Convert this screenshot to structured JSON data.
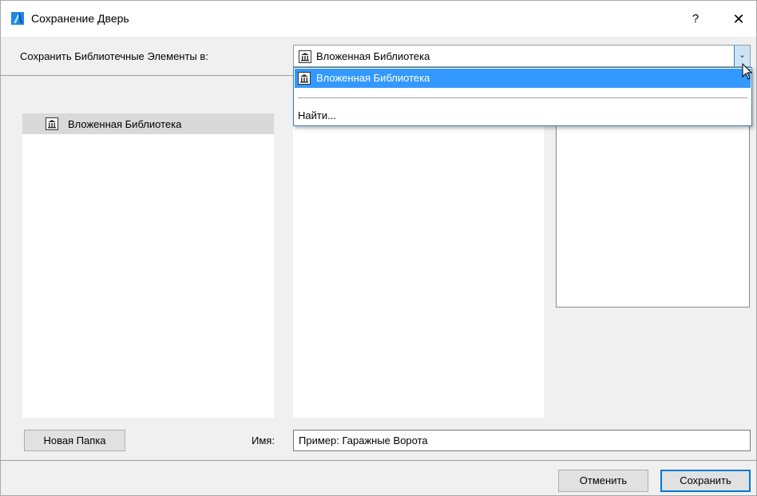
{
  "window": {
    "title": "Сохранение Дверь",
    "help_glyph": "?",
    "close_glyph": "✕"
  },
  "save_to": {
    "label": "Сохранить Библиотечные Элементы в:",
    "selected": "Вложенная Библиотека",
    "arrow_glyph": "⌄",
    "dropdown": {
      "items": [
        {
          "label": "Вложенная Библиотека",
          "icon": "library-icon",
          "selected": true
        }
      ],
      "find_label": "Найти..."
    }
  },
  "tree": {
    "items": [
      {
        "label": "Вложенная Библиотека",
        "icon": "library-icon"
      }
    ]
  },
  "footer": {
    "new_folder_label": "Новая Папка",
    "name_label": "Имя:",
    "name_value": "Пример: Гаражные Ворота",
    "cancel_label": "Отменить",
    "save_label": "Сохранить"
  },
  "colors": {
    "selection": "#3399ff",
    "accent_border": "#0078d7",
    "tree_selection": "#d9d9d9"
  }
}
